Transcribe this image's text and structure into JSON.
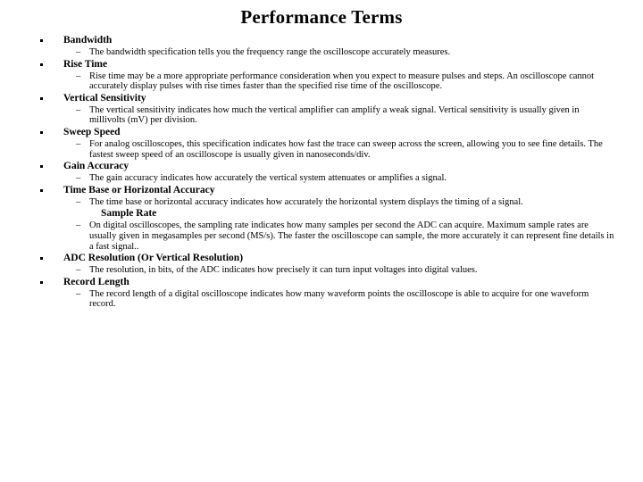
{
  "slide": {
    "title": "Performance Terms",
    "items": [
      {
        "heading": "Bandwidth",
        "bullet": true,
        "body": "The bandwidth specification tells you the frequency range the oscilloscope accurately measures."
      },
      {
        "heading": "Rise Time",
        "bullet": true,
        "body": "Rise time may be a more appropriate performance consideration when you expect to measure pulses and steps. An oscilloscope cannot accurately display pulses with rise times faster than the specified rise time of the oscilloscope."
      },
      {
        "heading": "Vertical Sensitivity",
        "bullet": true,
        "body": "The vertical sensitivity indicates how much the vertical amplifier can amplify a weak signal. Vertical sensitivity is usually given in millivolts (mV) per division."
      },
      {
        "heading": "Sweep Speed",
        "bullet": true,
        "body": "For analog oscilloscopes, this specification indicates how fast the trace can sweep across the screen, allowing you to see fine details. The fastest sweep speed of an oscilloscope is usually given in nanoseconds/div."
      },
      {
        "heading": "Gain Accuracy",
        "bullet": true,
        "body": "The gain accuracy indicates how accurately the vertical system attenuates or amplifies a signal."
      },
      {
        "heading": "Time Base or Horizontal Accuracy",
        "bullet": true,
        "body": "The time base or horizontal accuracy indicates how accurately the horizontal system displays the timing of a signal."
      },
      {
        "heading": "Sample Rate",
        "bullet": false,
        "body": "On digital oscilloscopes, the sampling rate indicates how many samples per second the ADC can acquire. Maximum sample rates are usually given in megasamples per second (MS/s). The faster the oscilloscope can sample, the more accurately it can represent fine details in a fast signal.."
      },
      {
        "heading": "ADC Resolution (Or Vertical Resolution)",
        "bullet": true,
        "body": "The resolution, in bits, of the ADC indicates how precisely it can turn input voltages into digital values."
      },
      {
        "heading": "Record Length",
        "bullet": true,
        "body": "The record length of a digital oscilloscope indicates how many waveform points the oscilloscope is able to acquire for one waveform record."
      }
    ],
    "dash_glyph": "–",
    "bullet_glyph": "▪"
  }
}
